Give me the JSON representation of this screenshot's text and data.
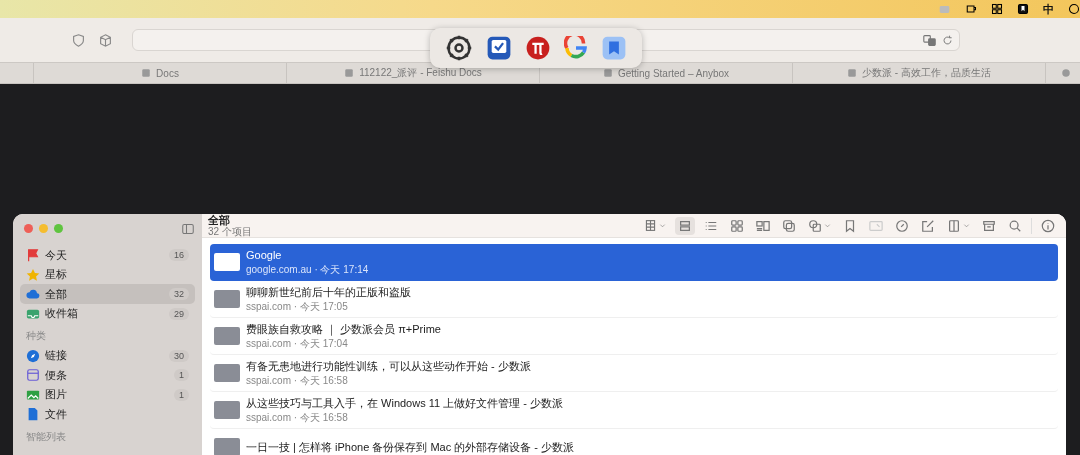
{
  "menubar": {
    "input_method": "中"
  },
  "browser": {
    "tabs": [
      {
        "label": "Docs",
        "selected": false
      },
      {
        "label": "112122_派评 - Feishu Docs",
        "selected": false
      },
      {
        "label": "Getting Started – Anybox",
        "selected": false
      },
      {
        "label": "少数派 - 高效工作，品质生活",
        "selected": false
      }
    ]
  },
  "app": {
    "sidebar": {
      "sections": [
        {
          "items": [
            {
              "label": "今天",
              "count": "16",
              "selected": false
            },
            {
              "label": "星标",
              "selected": false
            },
            {
              "label": "全部",
              "count": "32",
              "selected": true
            },
            {
              "label": "收件箱",
              "count": "29",
              "selected": false
            }
          ]
        },
        {
          "title": "种类",
          "items": [
            {
              "label": "链接",
              "count": "30",
              "selected": false
            },
            {
              "label": "便条",
              "count": "1",
              "selected": false
            },
            {
              "label": "图片",
              "count": "1",
              "selected": false
            },
            {
              "label": "文件",
              "selected": false
            }
          ]
        },
        {
          "title": "智能列表"
        }
      ]
    },
    "header": {
      "title": "全部",
      "subtitle": "32 个项目"
    },
    "view_buttons": [
      {
        "selected": true
      },
      {
        "selected": false
      },
      {
        "selected": false
      },
      {
        "selected": false
      }
    ],
    "rows": [
      {
        "title": "Google",
        "meta": "google.com.au · 今天 17:14",
        "selected": true
      },
      {
        "title": "聊聊新世纪前后十年的正版和盗版",
        "meta": "sspai.com · 今天 17:05",
        "selected": false
      },
      {
        "title": "费眼族自救攻略 ｜ 少数派会员 π+Prime",
        "meta": "sspai.com · 今天 17:04",
        "selected": false
      },
      {
        "title": "有备无患地进行功能性训练，可以从这些动作开始 - 少数派",
        "meta": "sspai.com · 今天 16:58",
        "selected": false
      },
      {
        "title": "从这些技巧与工具入手，在 Windows 11 上做好文件管理 - 少数派",
        "meta": "sspai.com · 今天 16:58",
        "selected": false
      },
      {
        "title": "一日一技 | 怎样将 iPhone 备份保存到 Mac 的外部存储设备 - 少数派",
        "selected": false
      }
    ]
  }
}
